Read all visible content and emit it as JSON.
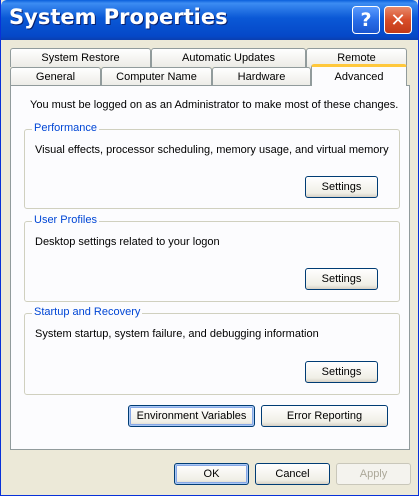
{
  "window": {
    "title": "System Properties"
  },
  "titlebar": {
    "help_label": "?",
    "close_label": "✕"
  },
  "tabs_back_row": [
    "System Restore",
    "Automatic Updates",
    "Remote"
  ],
  "tabs_front_row": [
    "General",
    "Computer Name",
    "Hardware",
    "Advanced"
  ],
  "active_tab": "Advanced",
  "panel": {
    "info": "You must be logged on as an Administrator to make most of these changes.",
    "performance": {
      "title": "Performance",
      "description": "Visual effects, processor scheduling, memory usage, and virtual memory",
      "button": "Settings"
    },
    "user_profiles": {
      "title": "User Profiles",
      "description": "Desktop settings related to your logon",
      "button": "Settings"
    },
    "startup_recovery": {
      "title": "Startup and Recovery",
      "description": "System startup, system failure, and debugging information",
      "button": "Settings"
    },
    "env_button": "Environment Variables",
    "error_button": "Error Reporting"
  },
  "dialog": {
    "ok": "OK",
    "cancel": "Cancel",
    "apply": "Apply"
  },
  "colors": {
    "titlebar": "#0a58d6",
    "face": "#ece9d8",
    "group_title": "#0046d5",
    "active_tab_accent": "#ffc83c"
  }
}
